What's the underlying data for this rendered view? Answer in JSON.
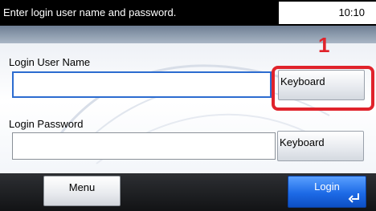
{
  "status_bar": {
    "message": "Enter login user name and password.",
    "time": "10:10"
  },
  "callout": {
    "number": "1"
  },
  "login": {
    "username_label": "Login User Name",
    "username_value": "",
    "password_label": "Login Password",
    "password_value": "",
    "keyboard_label": "Keyboard"
  },
  "bottom": {
    "menu_label": "Menu",
    "login_label": "Login"
  },
  "colors": {
    "highlight": "#e0232b",
    "accent": "#1d6ae6"
  },
  "icons": {
    "enter": "enter-return-icon"
  }
}
